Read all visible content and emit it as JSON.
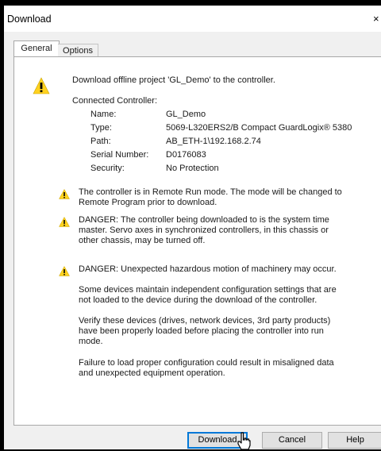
{
  "window": {
    "title": "Download",
    "close_glyph": "×"
  },
  "tabs": [
    {
      "label": "General",
      "active": true
    },
    {
      "label": "Options",
      "active": false
    }
  ],
  "intro": "Download offline project 'GL_Demo' to the controller.",
  "connected_controller": {
    "heading": "Connected Controller:",
    "fields": [
      {
        "label": "Name:",
        "value": "GL_Demo"
      },
      {
        "label": "Type:",
        "value": "5069-L320ERS2/B Compact GuardLogix® 5380"
      },
      {
        "label": "Path:",
        "value": "AB_ETH-1\\192.168.2.74"
      },
      {
        "label": "Serial Number:",
        "value": "D0176083"
      },
      {
        "label": "Security:",
        "value": "No Protection"
      }
    ]
  },
  "warnings": [
    {
      "lines": [
        "The controller is in Remote Run mode. The mode will be changed to",
        "Remote Program prior to download."
      ]
    },
    {
      "lines": [
        "DANGER: The controller being downloaded to is the system time",
        "master.  Servo axes in synchronized controllers, in this chassis or",
        "other chassis, may be turned off."
      ]
    },
    {
      "lines": [
        "DANGER: Unexpected hazardous motion of machinery may occur."
      ]
    }
  ],
  "notes": [
    {
      "lines": [
        "Some devices maintain independent configuration settings that are",
        "not loaded to the device during the download of the controller."
      ]
    },
    {
      "lines": [
        "Verify these devices (drives, network devices, 3rd party products)",
        "have been properly loaded before placing the controller into run",
        "mode."
      ]
    },
    {
      "lines": [
        "Failure to load proper configuration could result in misaligned data",
        "and unexpected equipment operation."
      ]
    }
  ],
  "buttons": {
    "download": "Download",
    "cancel": "Cancel",
    "help": "Help"
  },
  "icons": {
    "warning": "warning-icon",
    "cursor": "hand-pointer-icon"
  },
  "colors": {
    "warning_fill": "#ffd21f",
    "primary_border": "#0078d7"
  }
}
